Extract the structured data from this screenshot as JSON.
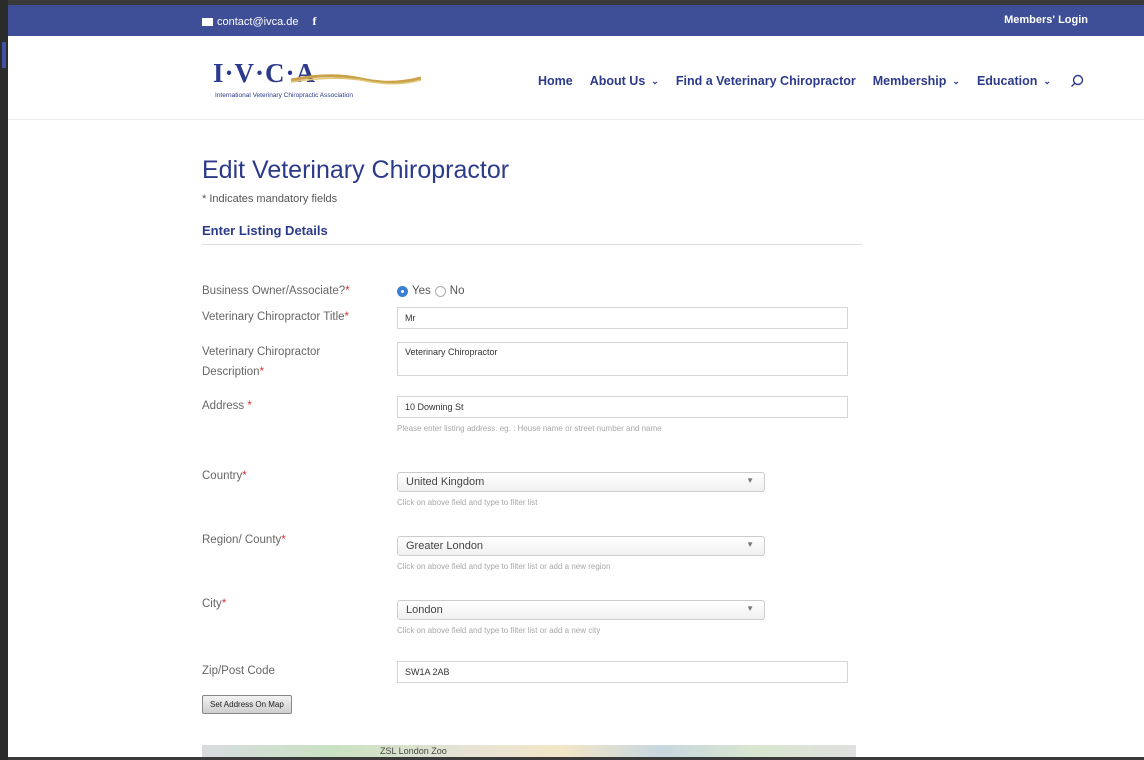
{
  "topbar": {
    "email": "contact@ivca.de",
    "facebook_glyph": "f",
    "members_login": "Members' Login"
  },
  "logo": {
    "letters": "I·V·C·A",
    "subtitle": "International Veterinary Chiropractic Association"
  },
  "nav": {
    "items": [
      {
        "label": "Home",
        "has_dropdown": false
      },
      {
        "label": "About Us",
        "has_dropdown": true
      },
      {
        "label": "Find a Veterinary Chiropractor",
        "has_dropdown": false
      },
      {
        "label": "Membership",
        "has_dropdown": true
      },
      {
        "label": "Education",
        "has_dropdown": true
      }
    ],
    "chevron": "⌄",
    "search_icon": "search-icon"
  },
  "page": {
    "title": "Edit Veterinary Chiropractor",
    "mandatory_note": "* Indicates mandatory fields",
    "section_title": "Enter Listing Details"
  },
  "form": {
    "business_owner": {
      "label": "Business Owner/Associate?",
      "req": "*",
      "yes": "Yes",
      "no": "No",
      "selected": "Yes"
    },
    "title": {
      "label": "Veterinary Chiropractor Title",
      "req": "*",
      "value": "Mr"
    },
    "description": {
      "label_line1": "Veterinary Chiropractor",
      "label_line2": "Description",
      "req": "*",
      "value": "Veterinary Chiropractor"
    },
    "address": {
      "label": "Address ",
      "req": "*",
      "value": "10 Downing St",
      "help": "Please enter listing address. eg. : House name or street number and name"
    },
    "country": {
      "label": "Country",
      "req": "*",
      "value": "United Kingdom",
      "help": "Click on above field and type to filter list"
    },
    "region": {
      "label": "Region/ County",
      "req": "*",
      "value": "Greater London",
      "help": "Click on above field and type to filter list or add a new region"
    },
    "city": {
      "label": "City",
      "req": "*",
      "value": "London",
      "help": "Click on above field and type to filter list or add a new city"
    },
    "zip": {
      "label": "Zip/Post Code",
      "value": "SW1A 2AB"
    },
    "set_address_button": "Set Address On Map"
  },
  "map": {
    "visible_label": "ZSL London Zoo"
  },
  "colors": {
    "brand_blue": "#3f4f97",
    "title_blue": "#2c3a8a",
    "required_red": "#dd3333",
    "radio_blue": "#3b7fd1"
  }
}
